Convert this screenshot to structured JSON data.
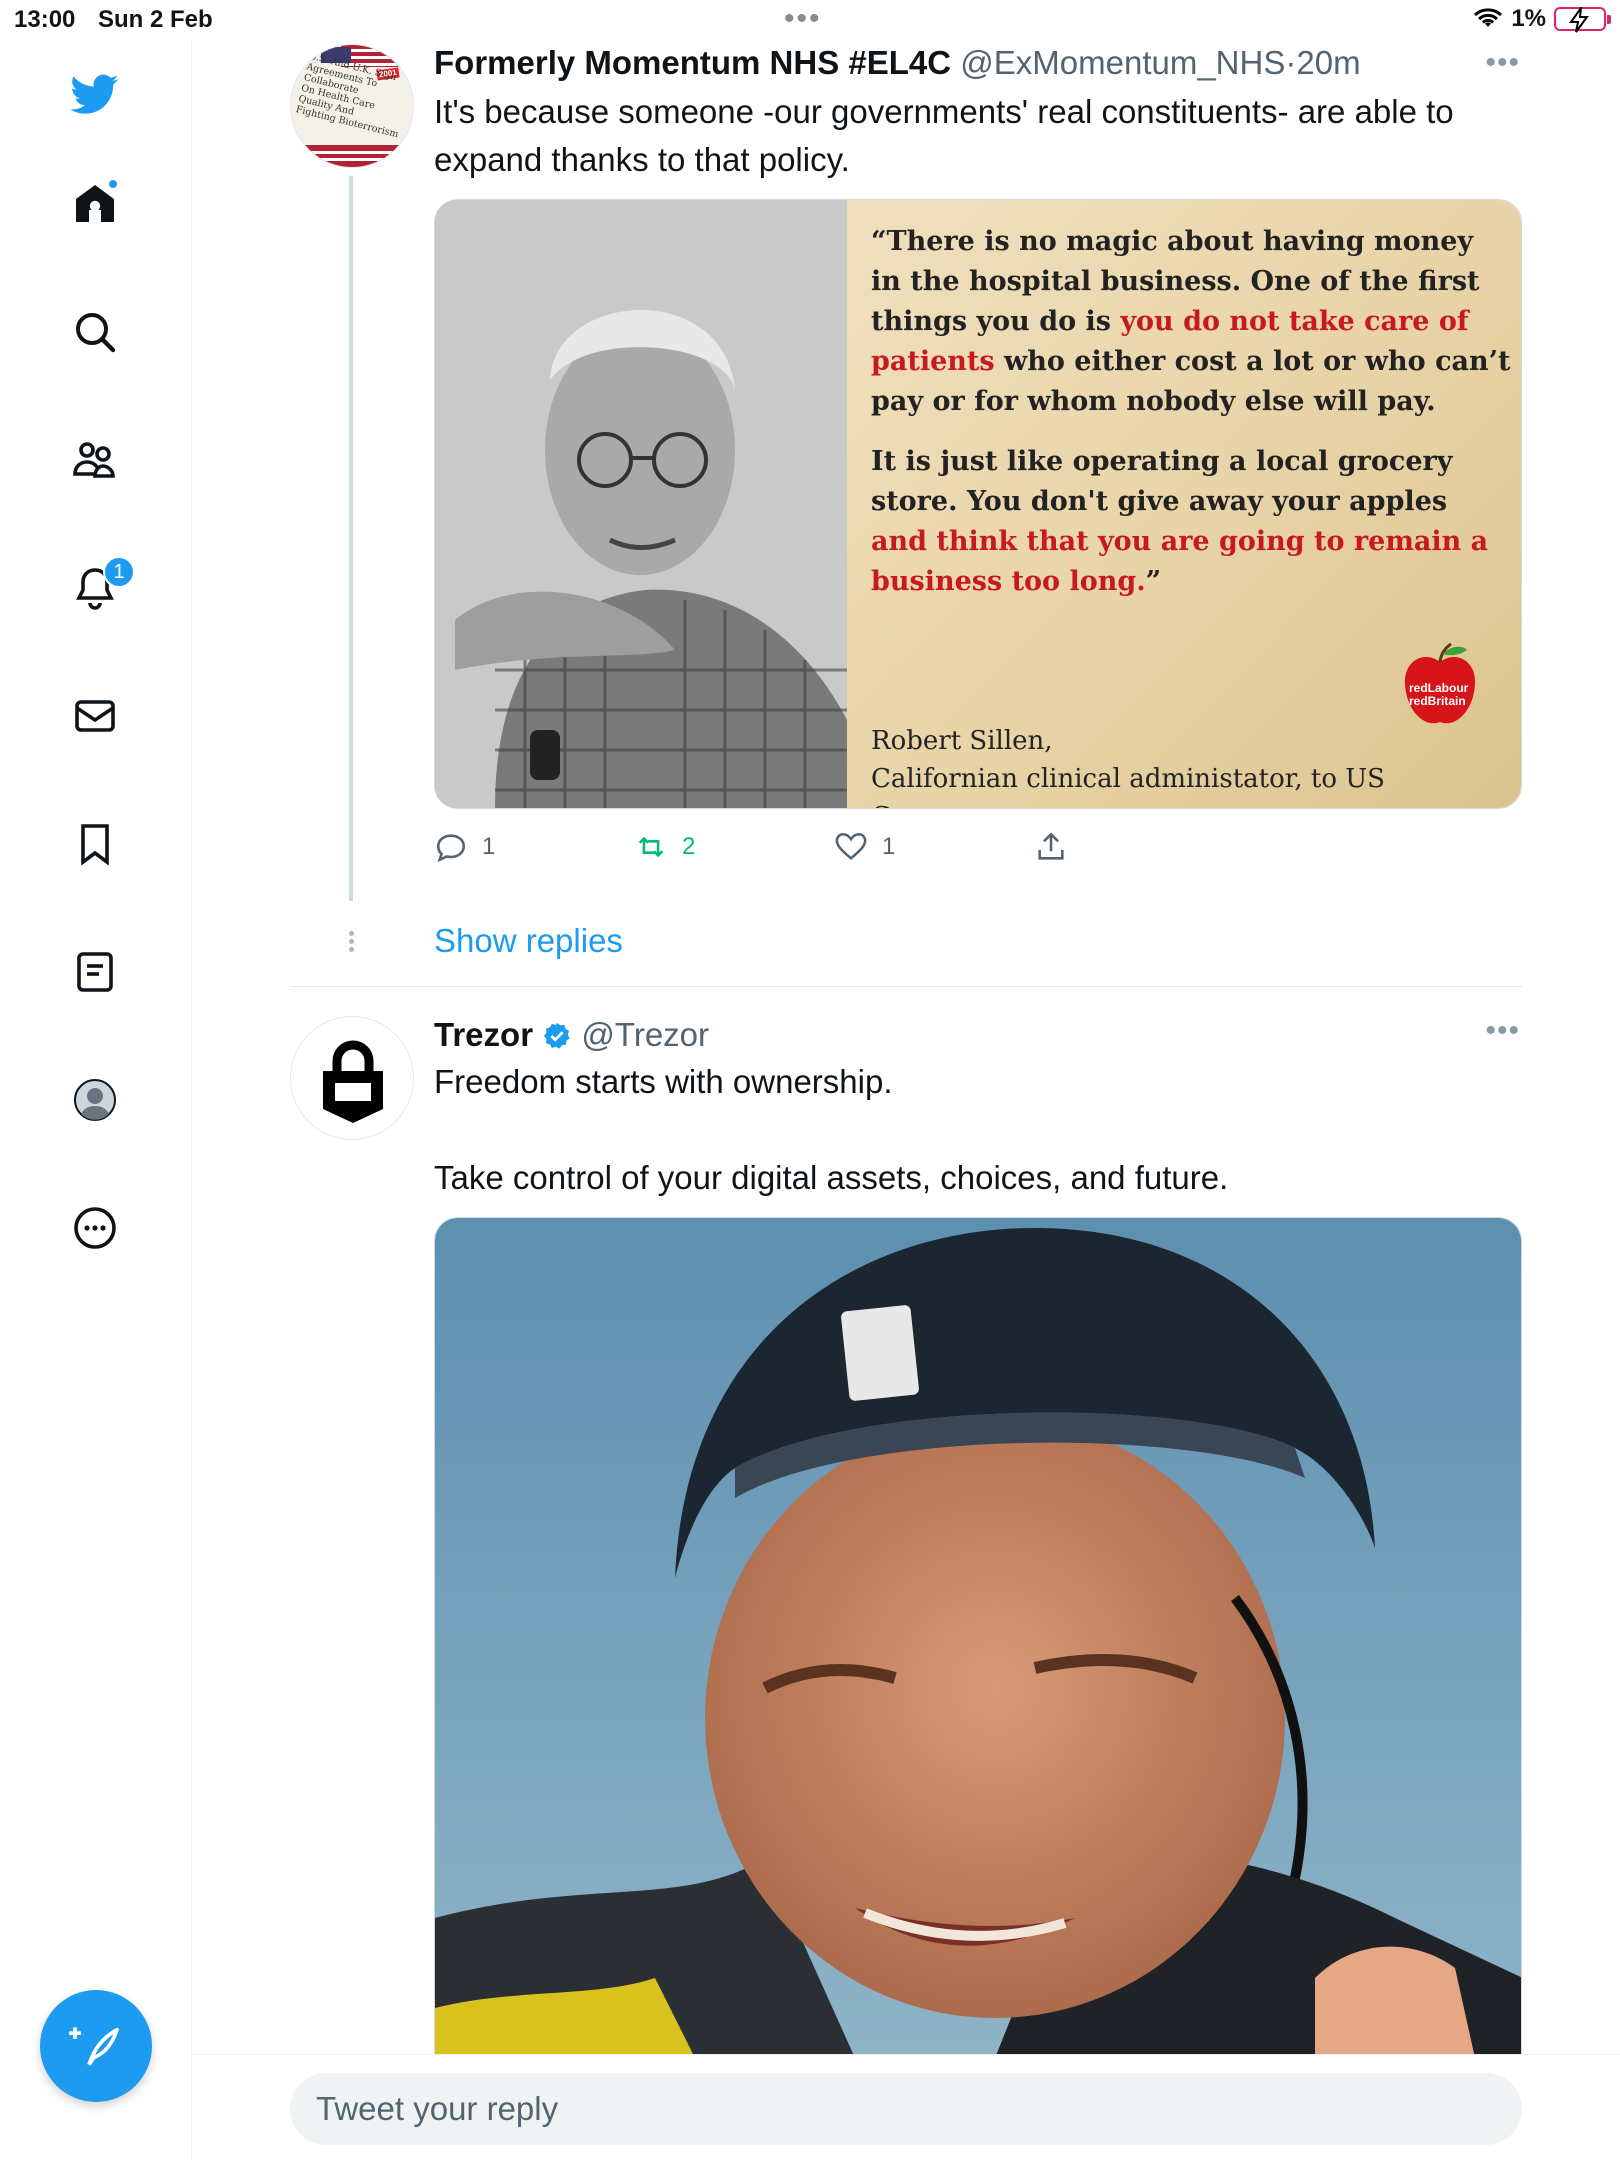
{
  "status_bar": {
    "time": "13:00",
    "date": "Sun 2 Feb",
    "battery": "1%"
  },
  "sidebar": {
    "notification_count": "1",
    "items": [
      "twitter-logo",
      "home-icon",
      "search-icon",
      "communities-icon",
      "bell-icon",
      "mail-icon",
      "bookmark-icon",
      "lists-icon",
      "profile-icon",
      "more-icon"
    ]
  },
  "tweet1": {
    "name": "Formerly Momentum NHS #EL4C",
    "handle": "@ExMomentum_NHS",
    "separator": "·",
    "time": "20m",
    "text": "It's because someone -our governments' real constituents- are able to expand thanks to that policy.",
    "avatar_lines": [
      "U.S. And U.K. Sign",
      "Agreements To Collaborate",
      "On Health Care Quality And",
      "Fighting Bioterrorism"
    ],
    "avatar_year": "2001",
    "quote": {
      "open": "“There is no magic about having money in the hospital business. One of the first things you do is ",
      "red1": "you do not take care of patients",
      "mid": " who either cost a lot or who can’t pay or for whom nobody else will pay.",
      "para2": "It is just like operating a local grocery store. You don't give away your apples ",
      "red2": "and think that you are going to remain a business too long.",
      "close": "”",
      "attribution_name": "Robert Sillen,",
      "attribution_role": "Californian clinical administator, to US Congress.",
      "logo_line1": "redLabour",
      "logo_line2": "redBritain"
    },
    "replies": "1",
    "retweets": "2",
    "likes": "1",
    "show_replies": "Show replies"
  },
  "tweet2": {
    "name": "Trezor",
    "handle": "@Trezor",
    "text": "Freedom starts with ownership.\n\nTake control of your digital assets, choices, and future."
  },
  "reply": {
    "placeholder": "Tweet your reply"
  },
  "colors": {
    "accent": "#1d9bf0",
    "retweet_green": "#00ba7c",
    "quote_red": "#c8191f"
  }
}
